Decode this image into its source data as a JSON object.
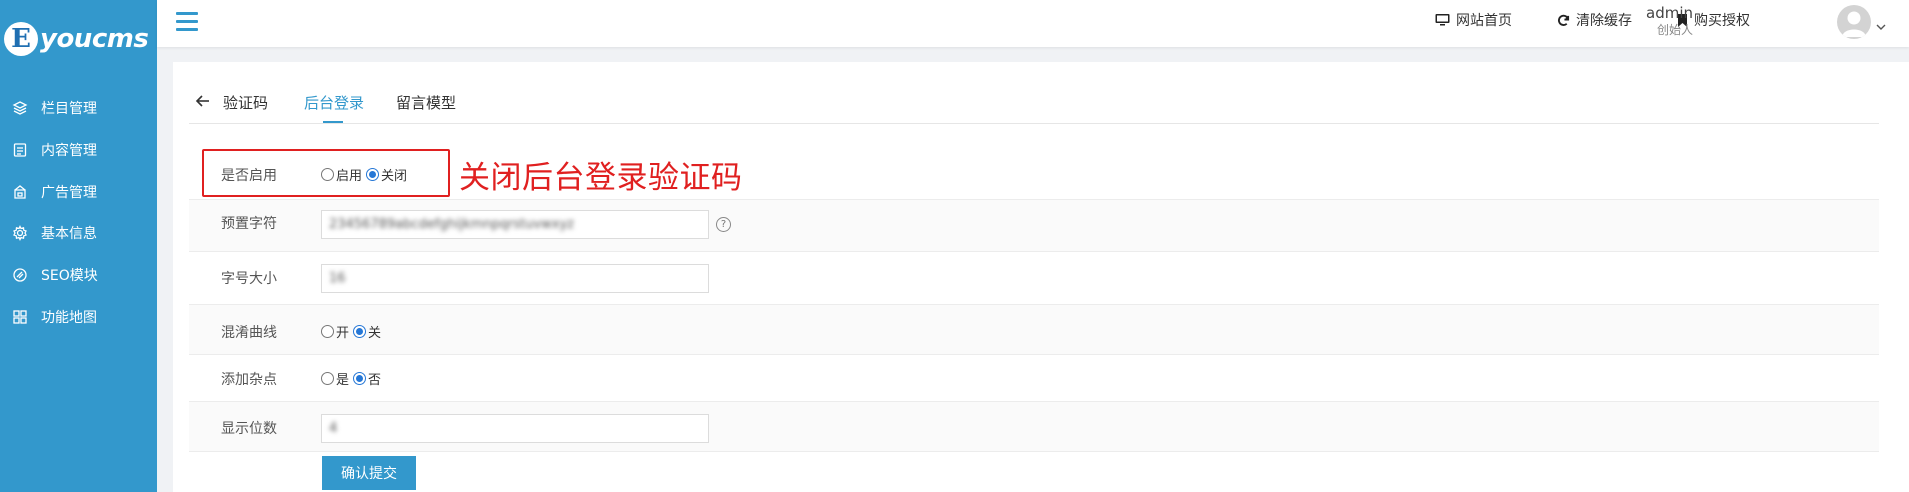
{
  "brand": {
    "logo_letter": "E",
    "logo_text": "youcms"
  },
  "sidebar": {
    "items": [
      {
        "label": "栏目管理",
        "icon": "layers-icon"
      },
      {
        "label": "内容管理",
        "icon": "document-icon"
      },
      {
        "label": "广告管理",
        "icon": "ad-icon"
      },
      {
        "label": "基本信息",
        "icon": "gear-icon"
      },
      {
        "label": "SEO模块",
        "icon": "seo-icon"
      },
      {
        "label": "功能地图",
        "icon": "grid-icon"
      }
    ]
  },
  "topbar": {
    "links": [
      {
        "label": "网站首页",
        "icon": "monitor-icon"
      },
      {
        "label": "清除缓存",
        "icon": "refresh-icon"
      },
      {
        "label": "购买授权",
        "icon": "bookmark-icon"
      }
    ],
    "user": {
      "name": "admin",
      "role": "创始人"
    }
  },
  "tabs": [
    {
      "label": "验证码",
      "active": false
    },
    {
      "label": "后台登录",
      "active": true
    },
    {
      "label": "留言模型",
      "active": false
    }
  ],
  "form": {
    "enable": {
      "label": "是否启用",
      "options": [
        "启用",
        "关闭"
      ],
      "selected": "关闭"
    },
    "preset_chars": {
      "label": "预置字符",
      "value": "23456789abcdefghijkmnpqrstuvwxyz"
    },
    "font_size": {
      "label": "字号大小",
      "value": "16"
    },
    "curve": {
      "label": "混淆曲线",
      "options": [
        "开",
        "关"
      ],
      "selected": "关"
    },
    "noise": {
      "label": "添加杂点",
      "options": [
        "是",
        "否"
      ],
      "selected": "否"
    },
    "length": {
      "label": "显示位数",
      "value": "4"
    },
    "submit_label": "确认提交"
  },
  "annotation": {
    "text": "关闭后台登录验证码",
    "color": "#e02020"
  },
  "colors": {
    "sidebar": "#3398cc",
    "accent": "#3398cc",
    "radio": "#2577d6"
  }
}
